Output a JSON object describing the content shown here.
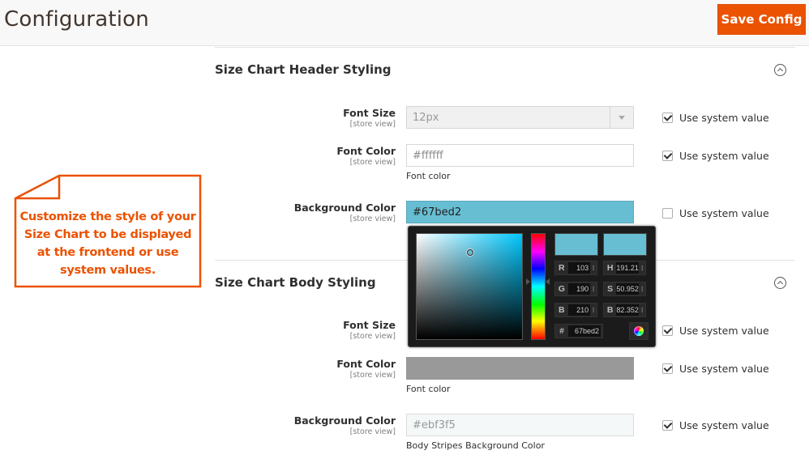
{
  "header": {
    "title": "Configuration",
    "save_label": "Save Config",
    "accent_color": "#eb5202"
  },
  "callout": {
    "text": "Customize the style of your Size Chart to be displayed at the frontend or use system values.",
    "color": "#eb5202"
  },
  "sections": [
    {
      "title": "Size Chart Header Styling",
      "collapse_icon": "chevron-up-circle-icon",
      "fields": [
        {
          "label": "Font Size",
          "scope": "[store view]",
          "type": "select",
          "value": "12px",
          "note": "",
          "use_system_value": true,
          "use_system_label": "Use system value"
        },
        {
          "label": "Font Color",
          "scope": "[store view]",
          "type": "text",
          "value": "#ffffff",
          "note": "Font color",
          "use_system_value": true,
          "use_system_label": "Use system value"
        },
        {
          "label": "Background Color",
          "scope": "[store view]",
          "type": "text",
          "value": "#67bed2",
          "note": "",
          "use_system_value": false,
          "use_system_label": "Use system value"
        }
      ]
    },
    {
      "title": "Size Chart Body Styling",
      "collapse_icon": "chevron-up-circle-icon",
      "fields": [
        {
          "label": "Font Size",
          "scope": "[store view]",
          "type": "select",
          "value": "",
          "note": "",
          "use_system_value": true,
          "use_system_label": "Use system value"
        },
        {
          "label": "Font Color",
          "scope": "[store view]",
          "type": "text",
          "value": "",
          "note": "Font color",
          "use_system_value": true,
          "use_system_label": "Use system value"
        },
        {
          "label": "Background Color",
          "scope": "[store view]",
          "type": "text",
          "value": "#ebf3f5",
          "note": "Body Stripes Background Color",
          "use_system_value": true,
          "use_system_label": "Use system value"
        }
      ]
    }
  ],
  "color_picker": {
    "current_color": "#67bed2",
    "previous_color": "#67bed2",
    "hue_base": "#00c8ff",
    "fields": {
      "r": {
        "key": "R",
        "value": "103"
      },
      "g": {
        "key": "G",
        "value": "190"
      },
      "b": {
        "key": "B",
        "value": "210"
      },
      "h": {
        "key": "H",
        "value": "191.21"
      },
      "s": {
        "key": "S",
        "value": "50.952"
      },
      "bright": {
        "key": "B",
        "value": "82.352"
      },
      "hex": {
        "key": "#",
        "value": "67bed2"
      }
    },
    "spin_glyph": "↕",
    "saturation_percent": 50.952,
    "brightness_percent": 82.352,
    "hue_degrees": 191.21
  },
  "body_font_color_swatch": "#999999"
}
